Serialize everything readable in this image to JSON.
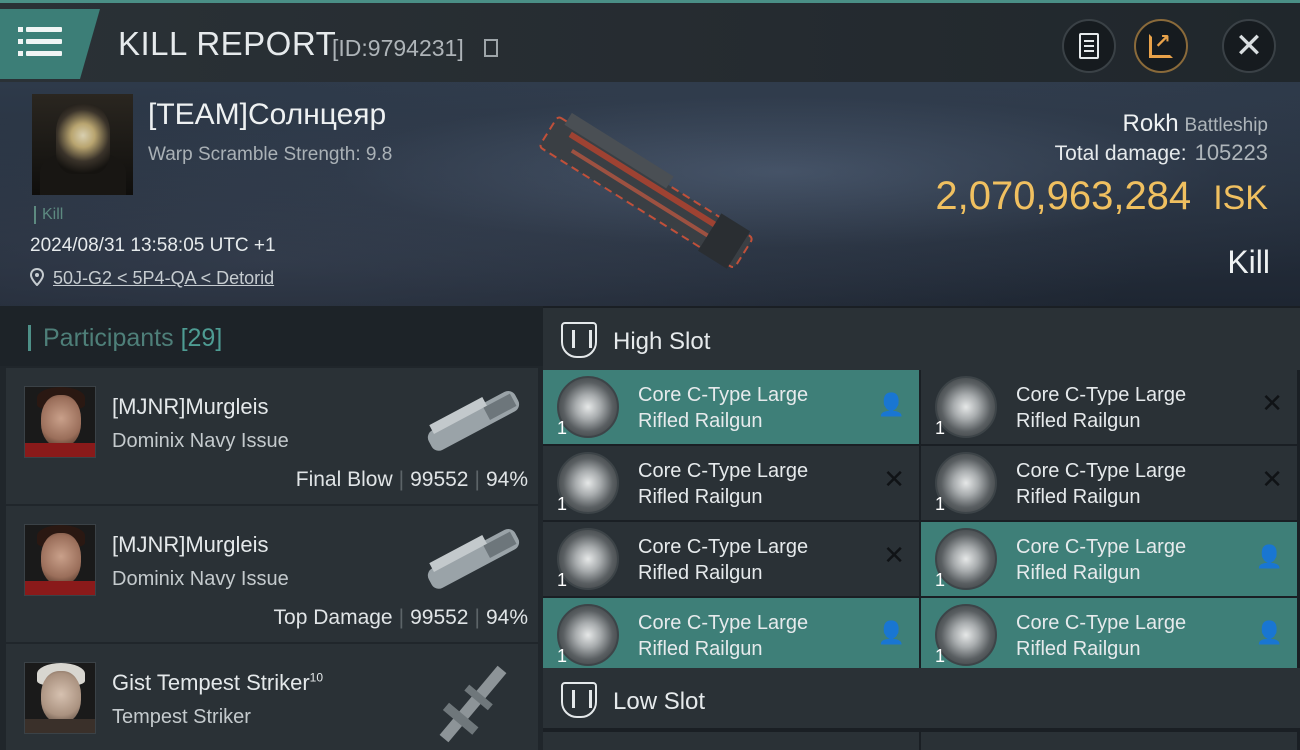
{
  "header": {
    "title": "KILL REPORT",
    "report_id": "[ID:9794231]"
  },
  "victim": {
    "pilot_name": "[TEAM]Солнцеяр",
    "warp_scramble": "Warp Scramble Strength: 9.8",
    "kill_tag": "Kill",
    "datetime": "2024/08/31 13:58:05 UTC +1",
    "location": "50J-G2 < 5P4-QA < Detorid",
    "ship_name": "Rokh",
    "ship_class": "Battleship",
    "total_damage_label": "Total damage:",
    "total_damage": "105223",
    "isk_value": "2,070,963,284",
    "isk_unit": "ISK",
    "result": "Kill"
  },
  "participants": {
    "title": "Participants",
    "count": "[29]",
    "rows": [
      {
        "name": "[MJNR]Murgleis",
        "ship": "Dominix Navy Issue",
        "role": "Final Blow",
        "damage": "99552",
        "percent": "94%"
      },
      {
        "name": "[MJNR]Murgleis",
        "ship": "Dominix Navy Issue",
        "role": "Top Damage",
        "damage": "99552",
        "percent": "94%"
      },
      {
        "name": "Gist Tempest Striker",
        "name_sup": "10",
        "ship": "Tempest Striker"
      }
    ]
  },
  "slots": {
    "high_label": "High Slot",
    "low_label": "Low Slot",
    "module_name_line1": "Core C-Type Large",
    "module_name_line2": "Rifled Railgun",
    "quantity": "1",
    "fitted_glyph": "👤",
    "destroyed_glyph": "✕",
    "modules": [
      {
        "status": "dropped"
      },
      {
        "status": "destroyed"
      },
      {
        "status": "destroyed"
      },
      {
        "status": "destroyed"
      },
      {
        "status": "destroyed"
      },
      {
        "status": "dropped"
      },
      {
        "status": "dropped"
      },
      {
        "status": "dropped"
      }
    ]
  },
  "colors": {
    "accent": "#3e7f78",
    "isk_gold": "#f0c060",
    "panel_dark": "#2a3136"
  }
}
